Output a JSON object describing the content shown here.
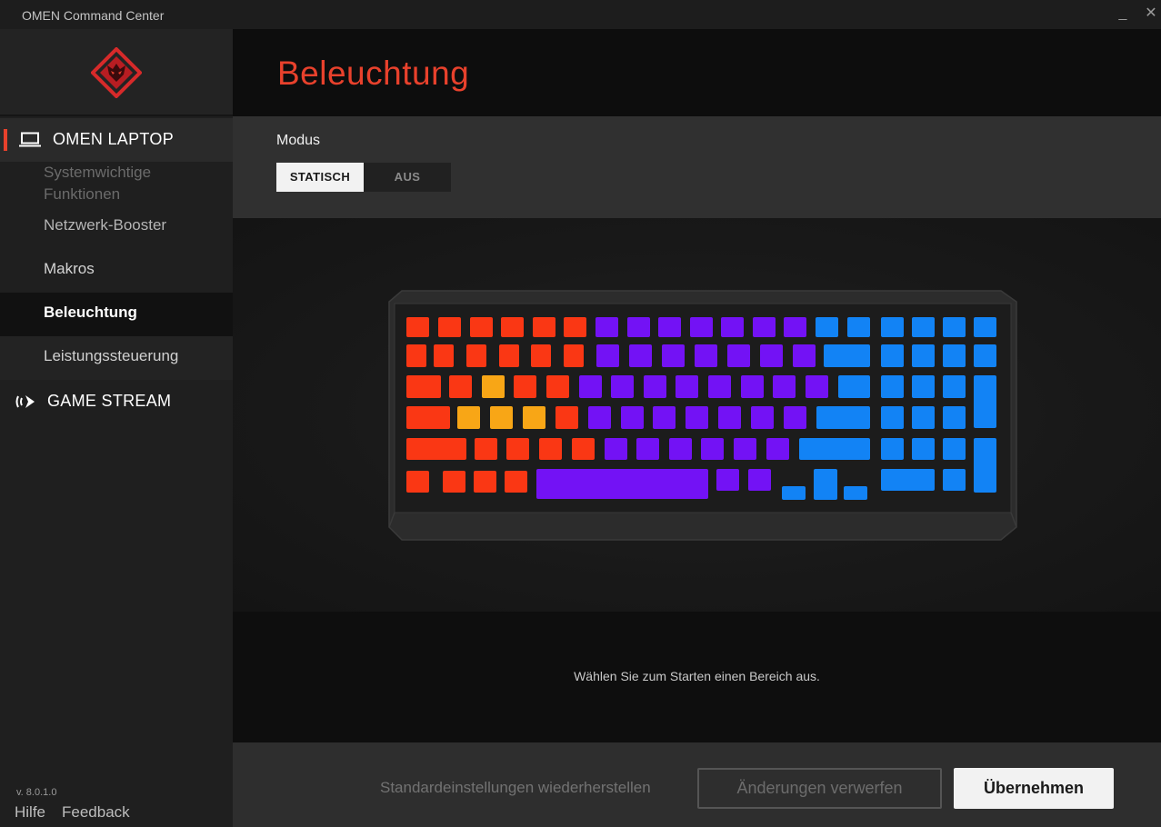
{
  "app": {
    "title": "OMEN Command Center"
  },
  "window": {
    "minimize_icon": "_",
    "close_icon": "✕"
  },
  "sidebar": {
    "logo_icon": "omen-logo-icon",
    "section_laptop": {
      "label": "OMEN LAPTOP",
      "icon": "laptop-icon"
    },
    "items": [
      {
        "label": "Systemwichtige Funktionen"
      },
      {
        "label": "Netzwerk-Booster"
      },
      {
        "label": "Makros"
      },
      {
        "label": "Beleuchtung",
        "active": true
      },
      {
        "label": "Leistungssteuerung"
      }
    ],
    "section_stream": {
      "label": "GAME STREAM",
      "icon": "game-stream-icon"
    },
    "version": "v. 8.0.1.0",
    "help": "Hilfe",
    "feedback": "Feedback"
  },
  "page": {
    "title": "Beleuchtung"
  },
  "mode": {
    "label": "Modus",
    "options": [
      "STATISCH",
      "AUS"
    ],
    "selected": "STATISCH"
  },
  "zones": {
    "red": "#fa3714",
    "orange": "#f8a616",
    "purple": "#7312f5",
    "blue": "#1283f5"
  },
  "info": {
    "text": "Wählen Sie zum Starten einen Bereich aus."
  },
  "footer": {
    "reset": "Standardeinstellungen wiederherstellen",
    "discard": "Änderungen verwerfen",
    "apply": "Übernehmen"
  },
  "colors": {
    "accent": "#e8412c",
    "background": "#1b1b1b"
  }
}
